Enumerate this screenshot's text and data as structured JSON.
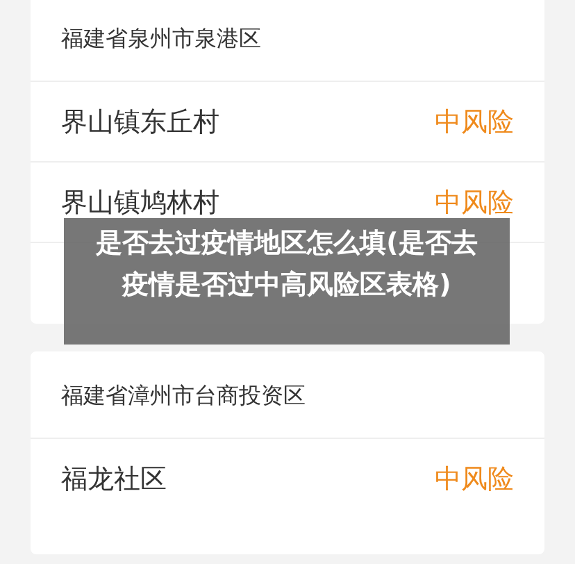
{
  "cards": [
    {
      "area": "福建省泉州市泉港区",
      "rows": [
        {
          "place": "界山镇东丘村",
          "risk": "中风险"
        },
        {
          "place": "界山镇鸠林村",
          "risk": "中风险"
        }
      ]
    },
    {
      "area": "福建省漳州市台商投资区",
      "rows": [
        {
          "place": "福龙社区",
          "risk": "中风险"
        }
      ]
    }
  ],
  "banner": {
    "title": "是否去过疫情地区怎么填(是否去疫情是否过中高风险区表格)"
  }
}
